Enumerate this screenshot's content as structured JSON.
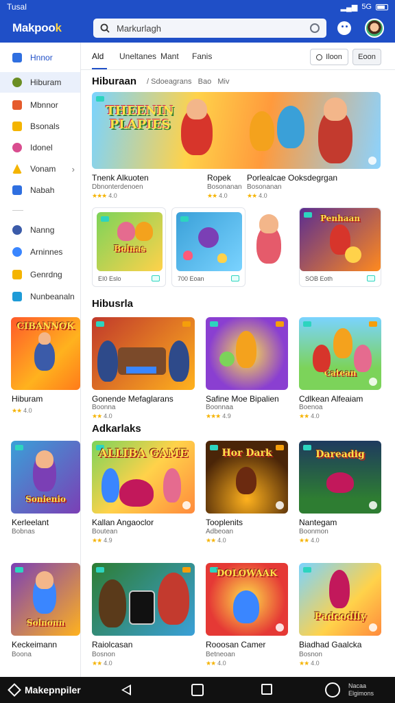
{
  "status": {
    "time": "Tusal",
    "signal": "5G",
    "battery": ""
  },
  "app": {
    "logo_a": "Makpoo",
    "logo_b": "k",
    "search_value": "Markurlagh"
  },
  "sidebar": {
    "items": [
      {
        "label": "Hnnor",
        "color": "#2f6fe0"
      },
      {
        "label": "Hiburam",
        "color": "#6b8e23"
      },
      {
        "label": "Mbnnor",
        "color": "#e55b2d"
      },
      {
        "label": "Bsonals",
        "color": "#f4b400"
      },
      {
        "label": "Idonel",
        "color": "#d94d8f"
      },
      {
        "label": "Vonam",
        "color": "#f4b400"
      },
      {
        "label": "Nabah",
        "color": "#2f6fe0"
      },
      {
        "label": "Nanng",
        "color": "#3b5ba9"
      },
      {
        "label": "Arninnes",
        "color": "#3a86ff"
      },
      {
        "label": "Genrdng",
        "color": "#f4b400"
      },
      {
        "label": "Nunbeanaln",
        "color": "#1e9bd7"
      }
    ]
  },
  "tabs": [
    "Ald",
    "Uneltanes",
    "Mant",
    "Fanis"
  ],
  "toolbar": {
    "search_label": "Iloon",
    "sort_label": "Eoon"
  },
  "featured": {
    "title": "Hiburaan",
    "sub_a": "Sdoeagrans",
    "sub_b": "Bao",
    "sub_c": "Miv",
    "banner_title": "THEENIN PLAPIES",
    "items": [
      {
        "name": "Tnenk Alkuoten",
        "sub": "Dbnonterdenoen",
        "rating": "4.0"
      },
      {
        "name": "Ropek",
        "sub": "Bosonanan",
        "rating": "4.0"
      },
      {
        "name": "Porlealcae Ooksdegrgan",
        "sub": "Bosonanan",
        "rating": "4.0"
      }
    ]
  },
  "mini_cards": [
    {
      "art": "Bolnas",
      "foot": "EI0 Eslo"
    },
    {
      "art": "",
      "foot": "700 Eoan"
    },
    {
      "art": "",
      "foot": ""
    },
    {
      "art": "Penhaan",
      "foot": "SOB Eoth"
    }
  ],
  "section2": {
    "title": "Hibusrla",
    "items": [
      {
        "art": "CIBANNOK",
        "name": "Hiburam",
        "sub": "",
        "rating": "4.0"
      },
      {
        "art": "",
        "name": "Gonende Mefaglarans",
        "sub": "Boonna",
        "rating": "4.0"
      },
      {
        "art": "",
        "name": "Safine Moe Bipalien",
        "sub": "Boonnaa",
        "rating": "4.9"
      },
      {
        "art": "Catean",
        "name": "Cdlkean Alfeaiam",
        "sub": "Boenoa",
        "rating": "4.0"
      }
    ]
  },
  "section3": {
    "title": "Adkarlaks",
    "items": [
      {
        "art": "Sonienio",
        "name": "Kerleelant",
        "sub": "Bobnas",
        "rating": ""
      },
      {
        "art": "ALLIBA GAME",
        "name": "Kallan Angaoclor",
        "sub": "Boutean",
        "rating": "4.9"
      },
      {
        "art": "Hor Dark",
        "name": "Tooplenits",
        "sub": "Adbeoan",
        "rating": "4.0"
      },
      {
        "art": "Dareadig",
        "name": "Nantegam",
        "sub": "Boonmon",
        "rating": "4.0"
      }
    ]
  },
  "section4": {
    "items": [
      {
        "art": "Solnonn",
        "name": "Keckeimann",
        "sub": "Boona",
        "rating": ""
      },
      {
        "art": "",
        "name": "Raiolcasan",
        "sub": "Bosnon",
        "rating": "4.0"
      },
      {
        "art": "DOLOWAAK",
        "name": "Rooosan Camer",
        "sub": "Betneoan",
        "rating": "4.0"
      },
      {
        "art": "Padcodlly",
        "name": "Biadhad Gaalcka",
        "sub": "Bosnon",
        "rating": "4.0"
      }
    ]
  },
  "navbar": {
    "brand": "Makepnpiler",
    "acct_a": "Nacaa",
    "acct_b": "Elgimons"
  }
}
